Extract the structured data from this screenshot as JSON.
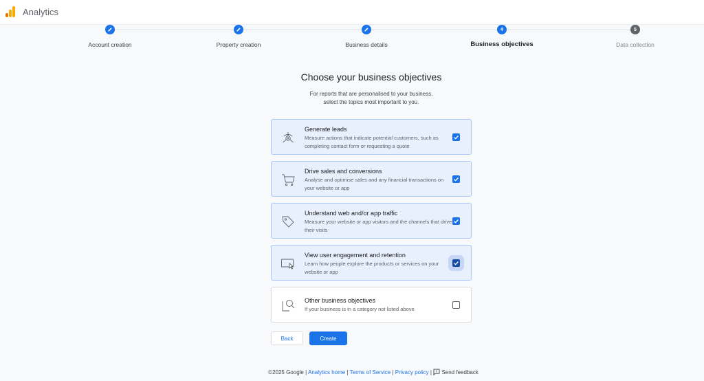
{
  "app": {
    "title": "Analytics",
    "logo_colors": [
      "#f9ab00",
      "#e37400"
    ]
  },
  "stepper": {
    "steps": [
      {
        "label": "Account creation",
        "state": "done"
      },
      {
        "label": "Property creation",
        "state": "done"
      },
      {
        "label": "Business details",
        "state": "done"
      },
      {
        "label": "Business objectives",
        "number": "4",
        "state": "active"
      },
      {
        "label": "Data collection",
        "number": "5",
        "state": "pending"
      }
    ]
  },
  "main": {
    "heading": "Choose your business objectives",
    "subhead_line1": "For reports that are personalised to your business,",
    "subhead_line2": "select the topics most important to you."
  },
  "options": [
    {
      "title": "Generate leads",
      "desc": "Measure actions that indicate potential customers, such as completing contact form or requesting a quote",
      "checked": true,
      "icon": "target-icon"
    },
    {
      "title": "Drive sales and conversions",
      "desc": "Analyse and optimise sales and any financial transactions on your website or app",
      "checked": true,
      "icon": "cart-icon"
    },
    {
      "title": "Understand web and/or app traffic",
      "desc": "Measure your website or app visitors and the channels that drive their visits",
      "checked": true,
      "icon": "tag-icon"
    },
    {
      "title": "View user engagement and retention",
      "desc": "Learn how people explore the products or services on your website or app",
      "checked": true,
      "icon": "screen-cursor-icon"
    },
    {
      "title": "Other business objectives",
      "desc": "If your business is in a category not listed above",
      "checked": false,
      "icon": "magnifier-doc-icon"
    }
  ],
  "actions": {
    "back": "Back",
    "create": "Create"
  },
  "footer": {
    "copyright": "©2025 Google",
    "analytics_home": "Analytics home",
    "terms": "Terms of Service",
    "privacy": "Privacy policy",
    "feedback": "Send feedback",
    "sep": "|"
  },
  "colors": {
    "accent": "#1a73e8",
    "selected_bg": "#e8f0fe",
    "selected_border": "#a8c7fa",
    "pending": "#5f6368"
  }
}
